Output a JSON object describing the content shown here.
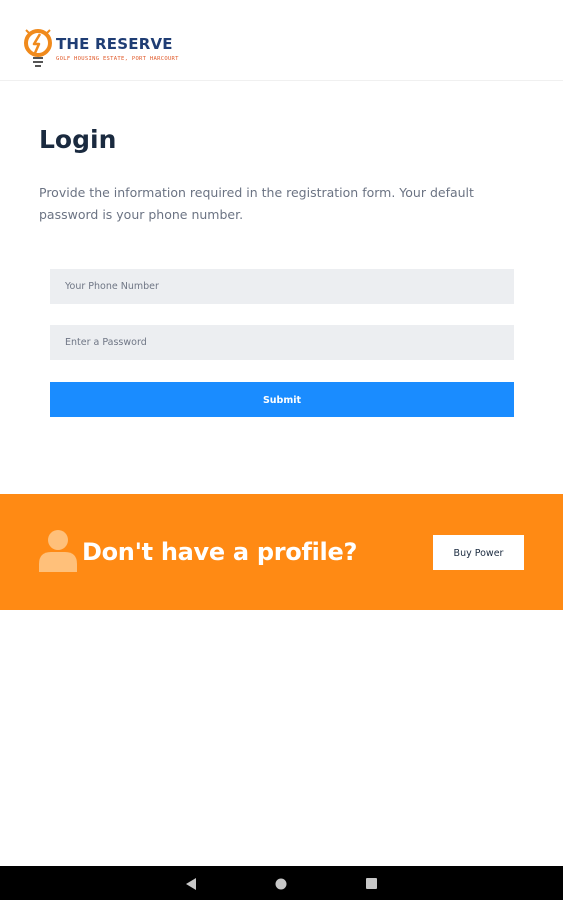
{
  "header": {
    "logo_title": "THE RESERVE",
    "logo_subtitle": "GOLF HOUSING ESTATE, PORT HARCOURT"
  },
  "login": {
    "title": "Login",
    "description": "Provide the information required in the registration form. Your default password is your phone number.",
    "phone_placeholder": "Your Phone Number",
    "password_placeholder": "Enter a Password",
    "submit_label": "Submit"
  },
  "banner": {
    "text": "Don't have a profile?",
    "buy_label": "Buy Power",
    "icon": "user-icon"
  },
  "navbar": {
    "icons": [
      "back-icon",
      "home-icon",
      "recents-icon"
    ]
  },
  "colors": {
    "accent_blue": "#1a8cff",
    "banner_orange": "#ff8a14",
    "title_dark": "#1a2a3f",
    "field_bg": "#eceef1"
  }
}
